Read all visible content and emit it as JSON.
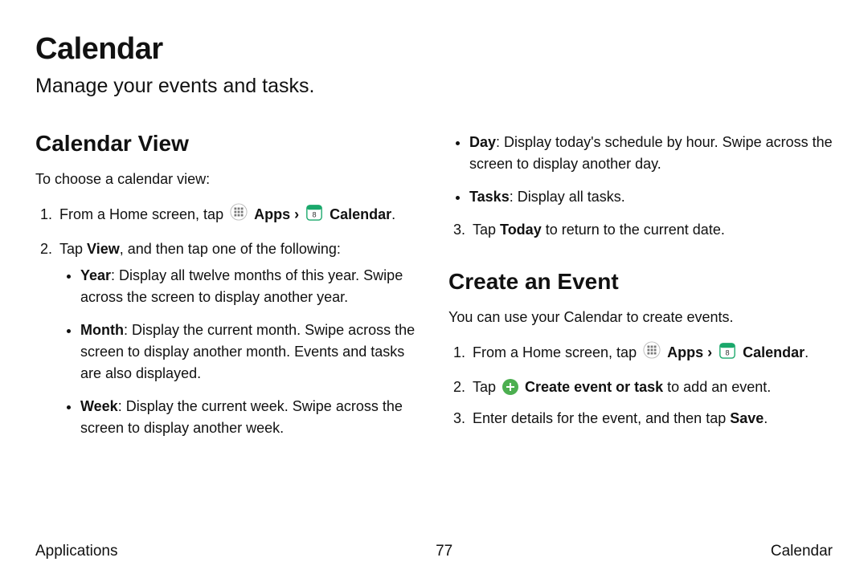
{
  "title": "Calendar",
  "subtitle": "Manage your events and tasks.",
  "labels": {
    "apps": "Apps",
    "calendar": "Calendar",
    "view": "View",
    "today": "Today",
    "save": "Save",
    "create_event_task": "Create event or task",
    "caret": "›"
  },
  "calendar_view": {
    "heading": "Calendar View",
    "intro": "To choose a calendar view:",
    "step1_pre": "From a Home screen, tap ",
    "step1_post": ".",
    "step2_pre": "Tap ",
    "step2_post": ", and then tap one of the following:",
    "bullets": {
      "year_label": "Year",
      "year_text": ": Display all twelve months of this year. Swipe across the screen to display another year.",
      "month_label": "Month",
      "month_text": ": Display the current month. Swipe across the screen to display another month. Events and tasks are also displayed.",
      "week_label": "Week",
      "week_text": ": Display the current week. Swipe across the screen to display another week.",
      "day_label": "Day",
      "day_text": ": Display today's schedule by hour. Swipe across the screen to display another day.",
      "tasks_label": "Tasks",
      "tasks_text": ": Display all tasks."
    },
    "step3_pre": "Tap ",
    "step3_post": " to return to the current date."
  },
  "create_event": {
    "heading": "Create an Event",
    "intro": "You can use your Calendar to create events.",
    "step1_pre": "From a Home screen, tap ",
    "step1_post": ".",
    "step2_pre": "Tap ",
    "step2_post": " to add an event.",
    "step3_pre": "Enter details for the event, and then tap ",
    "step3_post": "."
  },
  "footer": {
    "left": "Applications",
    "page": "77",
    "right": "Calendar"
  },
  "icons": {
    "apps": "apps-icon",
    "calendar": "calendar-icon",
    "plus": "plus-icon"
  }
}
